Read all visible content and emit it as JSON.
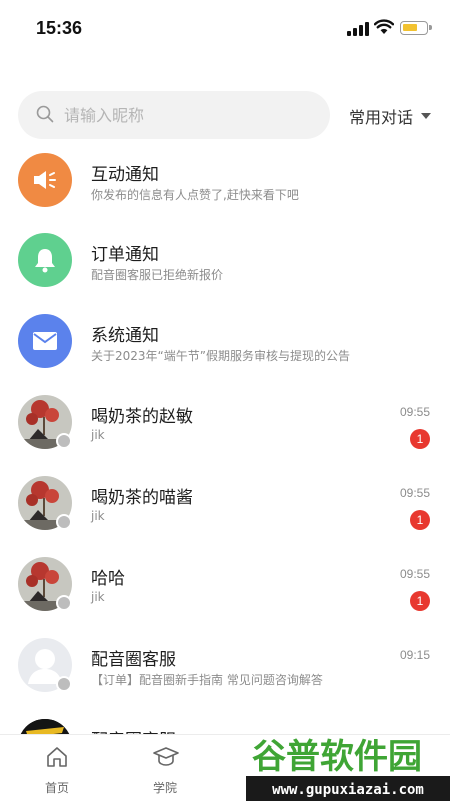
{
  "status_bar": {
    "time": "15:36"
  },
  "search": {
    "placeholder": "请输入昵称"
  },
  "filter": {
    "label": "常用对话"
  },
  "conversations": [
    {
      "title": "互动通知",
      "subtitle": "你发布的信息有人点赞了,赶快来看下吧",
      "time": "",
      "badge": "",
      "icon": "speaker-icon",
      "color": "#f08a43"
    },
    {
      "title": "订单通知",
      "subtitle": "配音圈客服已拒绝新报价",
      "time": "",
      "badge": "",
      "icon": "bell-icon",
      "color": "#5fd08f"
    },
    {
      "title": "系统通知",
      "subtitle": "关于2023年“端午节”假期服务审核与提现的公告",
      "time": "",
      "badge": "",
      "icon": "mail-icon",
      "color": "#5b82ec"
    },
    {
      "title": "喝奶茶的赵敏",
      "subtitle": "jik",
      "time": "09:55",
      "badge": "1",
      "icon": "user-avatar"
    },
    {
      "title": "喝奶茶的喵酱",
      "subtitle": "jik",
      "time": "09:55",
      "badge": "1",
      "icon": "user-avatar"
    },
    {
      "title": "哈哈",
      "subtitle": "jik",
      "time": "09:55",
      "badge": "1",
      "icon": "user-avatar"
    },
    {
      "title": "配音圈客服",
      "subtitle": "【订单】配音圈新手指南 常见问题咨询解答",
      "time": "09:15",
      "badge": "",
      "icon": "default-avatar"
    },
    {
      "title": "配音圈客服",
      "subtitle": "",
      "time": "",
      "badge": "",
      "icon": "service-avatar"
    }
  ],
  "tabbar": {
    "items": [
      {
        "label": "首页",
        "icon": "home-icon"
      },
      {
        "label": "学院",
        "icon": "graduation-cap-icon"
      }
    ]
  },
  "watermark": {
    "brand": "谷普软件园",
    "url": "www.gupuxiazai.com"
  }
}
